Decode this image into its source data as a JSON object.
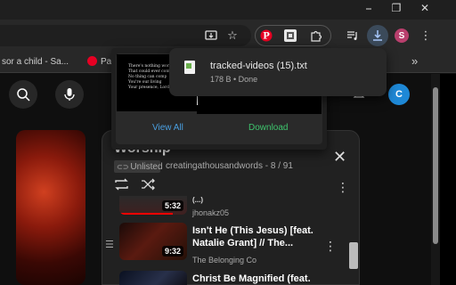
{
  "window_controls": {
    "minimize": "⎯",
    "restore": "❐",
    "close": "✕"
  },
  "toolbar": {
    "icons": [
      "install-app-icon",
      "bookmark-star-icon",
      "pinterest-icon",
      "extension-custom-icon",
      "puzzle-icon",
      "media-controls-icon",
      "download-icon",
      "profile-avatar",
      "menu-icon"
    ],
    "profile_letter": "S"
  },
  "bookmarks": {
    "item1": "sor a child - Sa...",
    "item2": "Pa",
    "overflow": "»"
  },
  "youtube": {
    "avatar_letter": "C"
  },
  "download_bubble": {
    "file_name": "tracked-videos (15).txt",
    "status": "178 B • Done"
  },
  "extension_popup": {
    "preview_text": [
      "There's nothing wor",
      "That could ever com",
      "No thing can comp",
      "You're our living",
      "Your presence, Lord"
    ],
    "view_all_label": "View All",
    "download_label": "Download",
    "view_all_color": "#4a9fe0",
    "download_color": "#3ec46d"
  },
  "playlist": {
    "title": "Worship",
    "visibility": "Unlisted",
    "owner": "creatingathousandwords",
    "position": "- 8 / 91",
    "items": [
      {
        "title": "(...)",
        "channel": "jhonakz05",
        "duration": "5:32"
      },
      {
        "title": "Isn't He (This Jesus) [feat. Natalie Grant] // The...",
        "channel": "The Belonging Co",
        "duration": "9:32"
      },
      {
        "title": "Christ Be Magnified (feat.",
        "channel": "",
        "duration": ""
      }
    ]
  }
}
